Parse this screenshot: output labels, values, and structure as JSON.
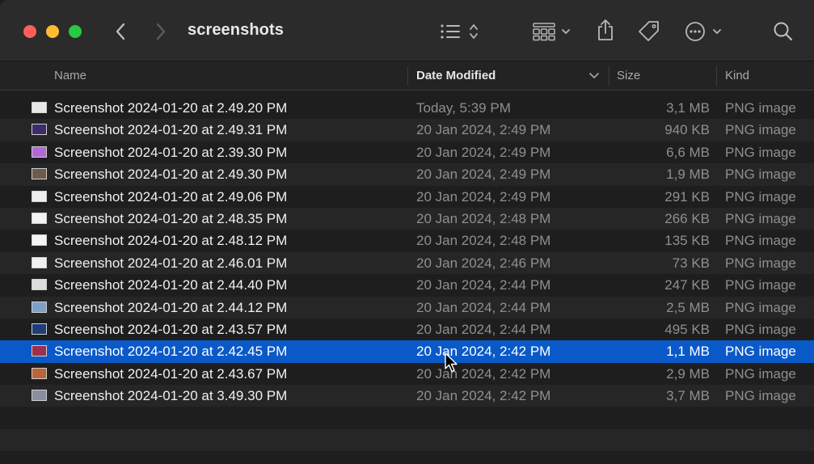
{
  "window": {
    "title": "screenshots"
  },
  "toolbar": {
    "back_icon": "chevron-left-icon",
    "forward_icon": "chevron-right-icon",
    "view_icon": "list-view-icon",
    "group_icon": "grid-group-icon",
    "share_icon": "share-icon",
    "tag_icon": "tag-icon",
    "more_icon": "ellipsis-circle-icon",
    "search_icon": "search-icon"
  },
  "columns": {
    "name": "Name",
    "date_modified": "Date Modified",
    "size": "Size",
    "kind": "Kind"
  },
  "files": [
    {
      "name": "Screenshot 2024-01-20 at 2.49.20 PM",
      "date": "Today, 5:39 PM",
      "size": "3,1 MB",
      "kind": "PNG image",
      "thumb": "#e8e8e8"
    },
    {
      "name": "Screenshot 2024-01-20 at 2.49.31 PM",
      "date": "20 Jan 2024, 2:49 PM",
      "size": "940 KB",
      "kind": "PNG image",
      "thumb": "#3b2d6b"
    },
    {
      "name": "Screenshot 2024-01-20 at 2.39.30 PM",
      "date": "20 Jan 2024, 2:49 PM",
      "size": "6,6 MB",
      "kind": "PNG image",
      "thumb": "#b06ad6"
    },
    {
      "name": "Screenshot 2024-01-20 at 2.49.30 PM",
      "date": "20 Jan 2024, 2:49 PM",
      "size": "1,9 MB",
      "kind": "PNG image",
      "thumb": "#6d5a4a"
    },
    {
      "name": "Screenshot 2024-01-20 at 2.49.06 PM",
      "date": "20 Jan 2024, 2:49 PM",
      "size": "291 KB",
      "kind": "PNG image",
      "thumb": "#eeeeee"
    },
    {
      "name": "Screenshot 2024-01-20 at 2.48.35 PM",
      "date": "20 Jan 2024, 2:48 PM",
      "size": "266 KB",
      "kind": "PNG image",
      "thumb": "#f2f2f2"
    },
    {
      "name": "Screenshot 2024-01-20 at 2.48.12 PM",
      "date": "20 Jan 2024, 2:48 PM",
      "size": "135 KB",
      "kind": "PNG image",
      "thumb": "#f4f4f4"
    },
    {
      "name": "Screenshot 2024-01-20 at 2.46.01 PM",
      "date": "20 Jan 2024, 2:46 PM",
      "size": "73 KB",
      "kind": "PNG image",
      "thumb": "#f0f0f0"
    },
    {
      "name": "Screenshot 2024-01-20 at 2.44.40 PM",
      "date": "20 Jan 2024, 2:44 PM",
      "size": "247 KB",
      "kind": "PNG image",
      "thumb": "#dcdcdc"
    },
    {
      "name": "Screenshot 2024-01-20 at 2.44.12 PM",
      "date": "20 Jan 2024, 2:44 PM",
      "size": "2,5 MB",
      "kind": "PNG image",
      "thumb": "#7ca0c8"
    },
    {
      "name": "Screenshot 2024-01-20 at 2.43.57 PM",
      "date": "20 Jan 2024, 2:44 PM",
      "size": "495 KB",
      "kind": "PNG image",
      "thumb": "#1f3d78"
    },
    {
      "name": "Screenshot 2024-01-20 at 2.42.45 PM",
      "date": "20 Jan 2024, 2:42 PM",
      "size": "1,1 MB",
      "kind": "PNG image",
      "thumb": "#a0304a",
      "selected": true
    },
    {
      "name": "Screenshot 2024-01-20 at 2.43.67 PM",
      "date": "20 Jan 2024, 2:42 PM",
      "size": "2,9 MB",
      "kind": "PNG image",
      "thumb": "#b8673a"
    },
    {
      "name": "Screenshot 2024-01-20 at 3.49.30 PM",
      "date": "20 Jan 2024, 2:42 PM",
      "size": "3,7 MB",
      "kind": "PNG image",
      "thumb": "#8a8ea0"
    }
  ],
  "colors": {
    "selection": "#0a59c9",
    "close": "#fe5f57",
    "minimize": "#febc2e",
    "maximize": "#28c840"
  }
}
